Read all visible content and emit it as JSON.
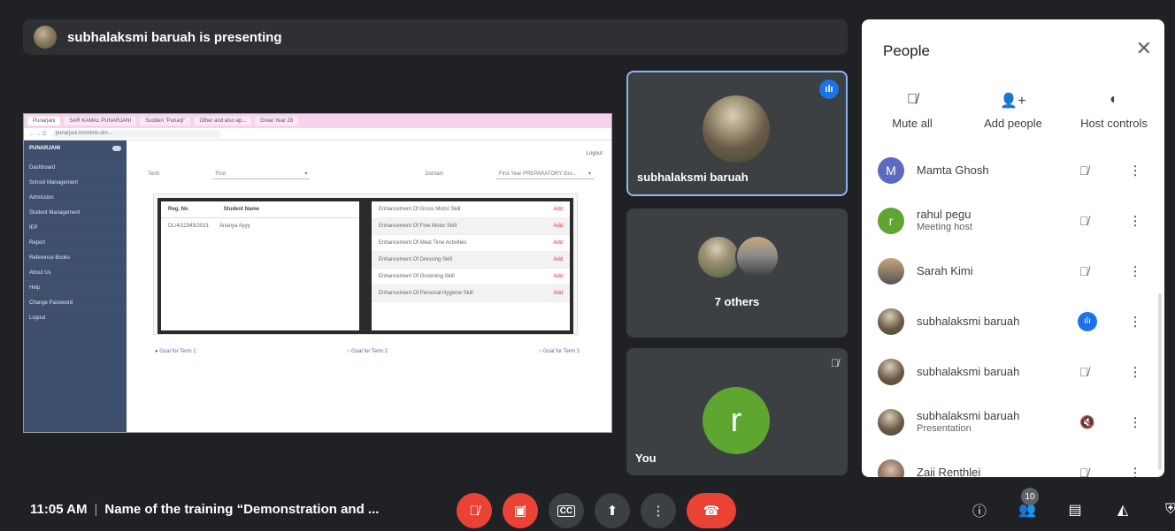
{
  "banner": {
    "text": "subhalaksmi baruah is presenting"
  },
  "shared_screen": {
    "tabs": [
      "Punarjani",
      "SAR KAMAL PUNARJANI",
      "Sudden \"Punarji\"",
      "Other and also ap...",
      "Great Year 28"
    ],
    "url": "punarjani.in/online-drs...",
    "app_name": "PUNARJANI",
    "sidebar_items": [
      "Dashboard",
      "School Management",
      "Admission",
      "Student Management",
      "IEP",
      "Report",
      "Reference Books",
      "About Us",
      "Help",
      "Change Password",
      "Logout"
    ],
    "top_link": "Logout",
    "filter_left_label": "Term",
    "filter_left_value": "First",
    "filter_right_label": "Domain",
    "filter_right_value": "First Year PREPARATORY Gro...",
    "table_headers": [
      "Reg. No",
      "Student Name"
    ],
    "table_row": [
      "DL/4/12345/2021",
      "Ananya Ayyy"
    ],
    "skills": [
      "Enhancement Of Gross Motor Skill",
      "Enhancement Of Fine Motor Skill",
      "Enhancement Of Meal Time Activities",
      "Enhancement Of Dressing Skill",
      "Enhancement Of Grooming Skill",
      "Enhancement Of Personal Hygiene Skill"
    ],
    "add_label": "Add",
    "goals": [
      "Goal for Term 1",
      "Goal for Term 2",
      "Goal for Term 3"
    ]
  },
  "tiles": {
    "presenter_name": "subhalaksmi baruah",
    "others_label": "7 others",
    "you_label": "You",
    "you_initial": "r"
  },
  "people_panel": {
    "title": "People",
    "actions": [
      {
        "label": "Mute all",
        "icon": "mic-off-icon"
      },
      {
        "label": "Add people",
        "icon": "add-person-icon"
      },
      {
        "label": "Host controls",
        "icon": "toggle-icon"
      }
    ],
    "participants": [
      {
        "name": "Mamta Ghosh",
        "sub": "",
        "initial": "M",
        "color": "#5c6bc0",
        "mic": "muted"
      },
      {
        "name": "rahul pegu",
        "sub": "Meeting host",
        "initial": "r",
        "color": "#5ea630",
        "mic": "muted"
      },
      {
        "name": "Sarah Kimi",
        "sub": "",
        "initial": "",
        "color": "#6b6b6b",
        "mic": "muted"
      },
      {
        "name": "subhalaksmi baruah",
        "sub": "",
        "initial": "",
        "color": "#8a7b62",
        "mic": "speaking"
      },
      {
        "name": "subhalaksmi baruah",
        "sub": "",
        "initial": "",
        "color": "#8a7b62",
        "mic": "muted"
      },
      {
        "name": "subhalaksmi baruah",
        "sub": "Presentation",
        "initial": "",
        "color": "#8a7b62",
        "mic": "audio-off"
      },
      {
        "name": "Zaii Renthlei",
        "sub": "",
        "initial": "",
        "color": "#9e8a7a",
        "mic": "muted"
      }
    ]
  },
  "bottom_bar": {
    "time": "11:05 AM",
    "meeting_title": "Name of the training “Demonstration and ...",
    "people_count": "10"
  },
  "colors": {
    "accent": "#1a73e8",
    "danger": "#ea4335",
    "background": "#202124",
    "tile": "#3c4043"
  }
}
